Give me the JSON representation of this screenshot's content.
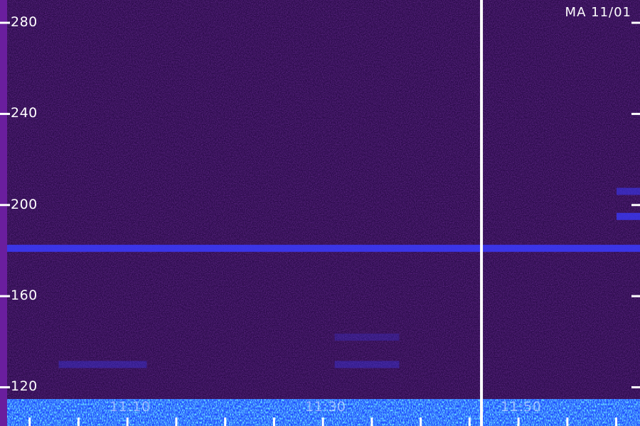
{
  "station_label": "MA 11/01",
  "colors": {
    "background": "#2a0a4a",
    "left_strip": "#6a1e9e",
    "marker_line": "#ffffff",
    "emission_band": "#3b3bff",
    "ground_noise_low": "#1a4bff",
    "ground_noise_high": "#9cff4a"
  },
  "chart_data": {
    "type": "heatmap",
    "ylim": [
      103,
      290
    ],
    "y_ticks": [
      "280",
      "240",
      "200",
      "160",
      "120"
    ],
    "y_tick_values": [
      280,
      240,
      200,
      160,
      120
    ],
    "x_tick_labels": [
      "11:10",
      "11:30",
      "11:50"
    ],
    "x_tick_times": [
      11.167,
      11.5,
      11.833
    ],
    "xlim": [
      10.95,
      12.04
    ],
    "marker_time": 11.77,
    "emission_bands": [
      {
        "y": 181,
        "intensity": 0.85,
        "xrange": [
          10.95,
          12.04
        ]
      },
      {
        "y": 195,
        "intensity": 0.75,
        "xrange": [
          12.0,
          12.04
        ]
      },
      {
        "y": 206,
        "intensity": 0.55,
        "xrange": [
          12.0,
          12.04
        ]
      },
      {
        "y": 130,
        "intensity": 0.35,
        "xrange": [
          11.05,
          11.2
        ]
      },
      {
        "y": 130,
        "intensity": 0.35,
        "xrange": [
          11.52,
          11.63
        ]
      },
      {
        "y": 142,
        "intensity": 0.25,
        "xrange": [
          11.52,
          11.63
        ]
      }
    ]
  }
}
